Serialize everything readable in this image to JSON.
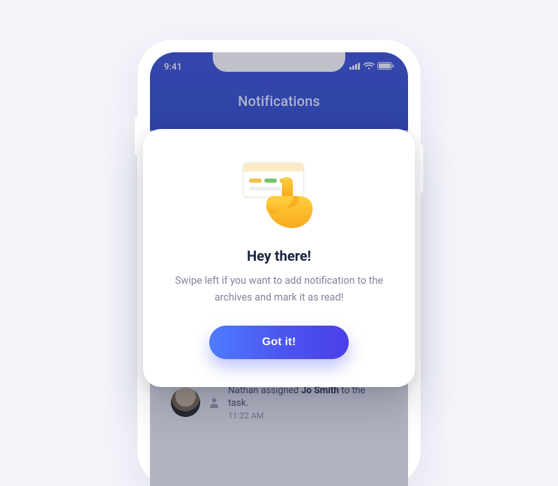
{
  "status": {
    "time": "9:41"
  },
  "header": {
    "title": "Notifications"
  },
  "notif": {
    "line_pre": "Nathan assigned ",
    "line_bold": "Jo Smith",
    "line_post": " to the task.",
    "time": "11:22 AM"
  },
  "modal": {
    "title": "Hey there!",
    "body": "Swipe left if you want to add notification to the archives and mark it as read!",
    "cta": "Got it!"
  }
}
